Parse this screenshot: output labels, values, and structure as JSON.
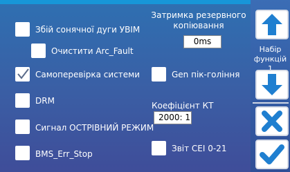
{
  "options": {
    "arc_fault": "Збій сонячної дуги УВІМ",
    "clear_arc_fault": "Очистити Arc_Fault",
    "self_check": "Самоперевірка системи",
    "gen_peak_shaving": "Gen пік-гоління",
    "drm": "DRM",
    "island_mode_signal": "Сигнал ОСТРІВНИЙ РЕЖИМ",
    "bms_err_stop": "BMS_Err_Stop",
    "cei_report": "Звіт CEI 0-21"
  },
  "checked": {
    "self_check": true
  },
  "backup_delay": {
    "label_line1": "Затримка резервного",
    "label_line2": "копіювання",
    "value": "0ms"
  },
  "ct_ratio": {
    "label": "Коефіцієнт КТ",
    "value": "2000: 1"
  },
  "side": {
    "set_line1": "Набір",
    "set_line2": "функцій 1"
  },
  "colors": {
    "accent_blue": "#1796d8",
    "panel": "#3a5fa5",
    "icon_blue": "#1f7fd0"
  }
}
